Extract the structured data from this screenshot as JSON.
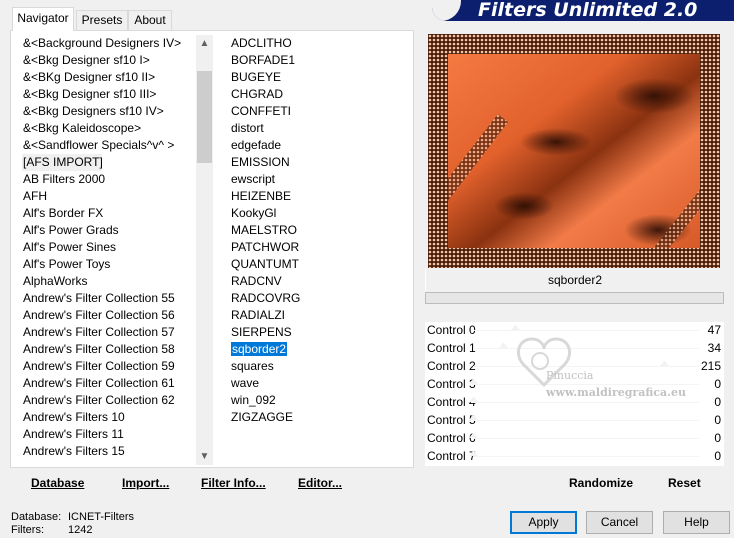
{
  "banner": {
    "title": "Filters Unlimited 2.0"
  },
  "tabs": [
    {
      "label": "Navigator",
      "active": true
    },
    {
      "label": "Presets",
      "active": false
    },
    {
      "label": "About",
      "active": false
    }
  ],
  "categories": [
    "&<Background Designers IV>",
    "&<Bkg Designer sf10 I>",
    "&<BKg Designer sf10 II>",
    "&<Bkg Designer sf10 III>",
    "&<Bkg Designers sf10 IV>",
    "&<Bkg Kaleidoscope>",
    "&<Sandflower Specials^v^ >",
    "[AFS IMPORT]",
    "AB Filters 2000",
    "AFH",
    "Alf's Border FX",
    "Alf's Power Grads",
    "Alf's Power Sines",
    "Alf's Power Toys",
    "AlphaWorks",
    "Andrew's Filter Collection 55",
    "Andrew's Filter Collection 56",
    "Andrew's Filter Collection 57",
    "Andrew's Filter Collection 58",
    "Andrew's Filter Collection 59",
    "Andrew's Filter Collection 61",
    "Andrew's Filter Collection 62",
    "Andrew's Filters 10",
    "Andrew's Filters 11",
    "Andrew's Filters 15"
  ],
  "selected_category": "[AFS IMPORT]",
  "filters": [
    "ADCLITHO",
    "BORFADE1",
    "BUGEYE",
    "CHGRAD",
    "CONFFETI",
    "distort",
    "edgefade",
    "EMISSION",
    "ewscript",
    "HEIZENBE",
    "KookyGl",
    "MAELSTRO",
    "PATCHWOR",
    "QUANTUMT",
    "RADCNV",
    "RADCOVRG",
    "RADIALZI",
    "SIERPENS",
    "sqborder2",
    "squares",
    "wave",
    "win_092",
    "ZIGZAGGE"
  ],
  "selected_filter": "sqborder2",
  "bottom_buttons": {
    "database": "Database",
    "import": "Import...",
    "filter_info": "Filter Info...",
    "editor": "Editor..."
  },
  "preview": {
    "filter_name": "sqborder2",
    "progress_fraction": 0
  },
  "controls": [
    {
      "label": "Control 0",
      "value": "47"
    },
    {
      "label": "Control 1",
      "value": "34"
    },
    {
      "label": "Control 2",
      "value": "215"
    },
    {
      "label": "Control 3",
      "value": "0"
    },
    {
      "label": "Control 4",
      "value": "0"
    },
    {
      "label": "Control 5",
      "value": "0"
    },
    {
      "label": "Control 6",
      "value": "0"
    },
    {
      "label": "Control 7",
      "value": "0"
    }
  ],
  "watermark": {
    "name": "Pinuccia",
    "site": "www.maldiregrafica.eu"
  },
  "right_buttons": {
    "randomize": "Randomize",
    "reset": "Reset"
  },
  "status": {
    "database_label": "Database:",
    "database_value": "ICNET-Filters",
    "filters_label": "Filters:",
    "filters_value": "1242"
  },
  "dialog_buttons": {
    "apply": "Apply",
    "cancel": "Cancel",
    "help": "Help"
  },
  "colors": {
    "banner": "#0b1f6e",
    "selection": "#0078d7",
    "preview_orange": "#ec6d3c"
  }
}
